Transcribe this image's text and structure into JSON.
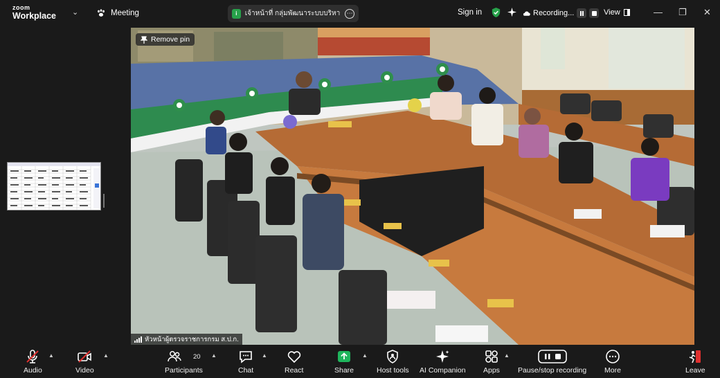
{
  "topbar": {
    "logo_line1": "zoom",
    "logo_line2": "Workplace",
    "meeting_label": "Meeting",
    "meeting_title": "เจ้าหน้าที่ กลุ่มพัฒนาระบบบริหาร ส.ป.ก.",
    "title_badge": "i",
    "sign_in": "Sign in",
    "recording_label": "Recording...",
    "view_label": "View"
  },
  "video": {
    "remove_pin_label": "Remove pin",
    "speaker_name": "หัวหน้าผู้ตรวจราชการกรม ส.ป.ก."
  },
  "toolbar": {
    "audio": "Audio",
    "video": "Video",
    "participants": "Participants",
    "participants_count": "20",
    "chat": "Chat",
    "react": "React",
    "share": "Share",
    "host_tools": "Host tools",
    "ai_companion": "AI Companion",
    "apps": "Apps",
    "pause_stop_recording": "Pause/stop recording",
    "more": "More",
    "leave": "Leave"
  },
  "colors": {
    "background": "#1a1a1a",
    "share_green": "#1fb55c",
    "muted_red": "#e0302f",
    "leave_red": "#e0302f",
    "shield_green": "#27a24a"
  }
}
